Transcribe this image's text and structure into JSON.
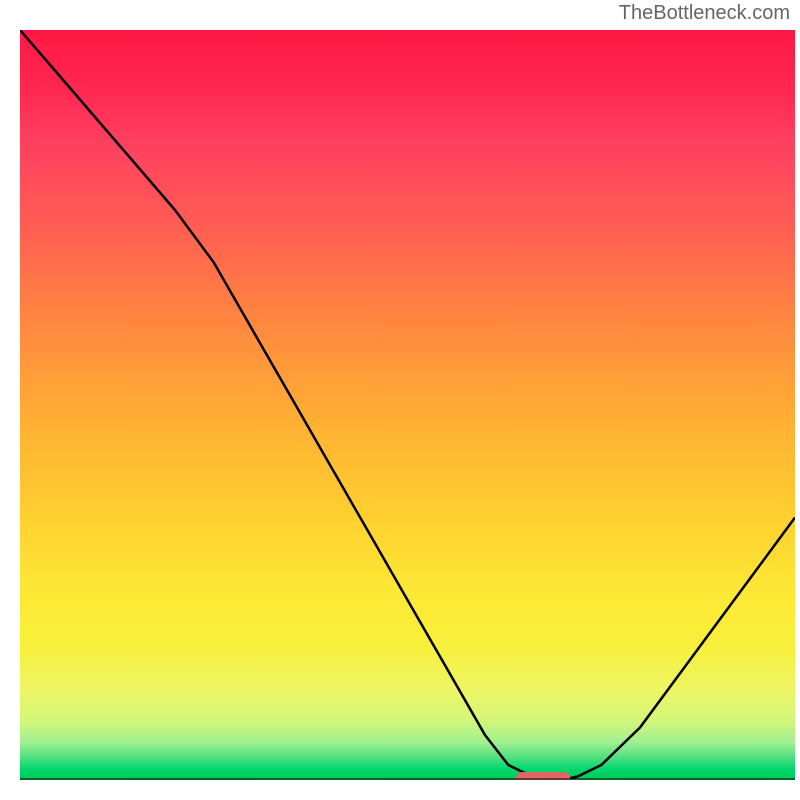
{
  "watermark": "TheBottleneck.com",
  "chart_data": {
    "type": "line",
    "title": "",
    "xlabel": "",
    "ylabel": "",
    "xlim": [
      0,
      100
    ],
    "ylim": [
      0,
      100
    ],
    "x": [
      0,
      5,
      10,
      15,
      20,
      25,
      30,
      35,
      40,
      45,
      50,
      55,
      60,
      63,
      66,
      68,
      70,
      72,
      75,
      80,
      85,
      90,
      95,
      100
    ],
    "values": [
      100,
      94,
      88,
      82,
      76,
      69,
      60,
      51,
      42,
      33,
      24,
      15,
      6,
      2,
      0.5,
      0,
      0,
      0.5,
      2,
      7,
      14,
      21,
      28,
      35
    ],
    "marker": {
      "x_start": 64,
      "x_end": 71,
      "y": 0
    },
    "gradient_note": "vertical color gradient from red (top) to green (bottom) represents bottleneck severity",
    "grid": false,
    "legend": false
  }
}
